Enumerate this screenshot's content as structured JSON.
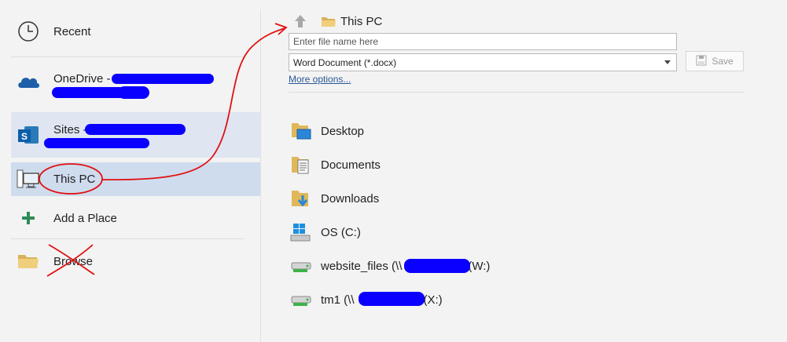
{
  "places": {
    "recent": "Recent",
    "onedrive": "OneDrive -",
    "sites": "Sites -",
    "this_pc": "This PC",
    "add_place": "Add a Place",
    "browse": "Browse"
  },
  "breadcrumb": "This PC",
  "filename": {
    "placeholder": "Enter file name here",
    "value": ""
  },
  "file_type": "Word Document (*.docx)",
  "save_label": "Save",
  "more_options": "More options...",
  "locations": [
    {
      "label": "Desktop",
      "icon": "desktop-folder-icon"
    },
    {
      "label": "Documents",
      "icon": "documents-folder-icon"
    },
    {
      "label": "Downloads",
      "icon": "downloads-folder-icon"
    },
    {
      "label": "OS (C:)",
      "icon": "windows-drive-icon"
    },
    {
      "prefix": "website_files (\\\\",
      "suffix": "(W:)",
      "icon": "network-drive-icon"
    },
    {
      "prefix": "tm1 (\\\\",
      "suffix": "(X:)",
      "icon": "network-drive-icon"
    }
  ],
  "colors": {
    "selection": "#cfdcee",
    "annotation_red": "#e01010",
    "redaction": "#0a00ff",
    "link": "#2b5797"
  }
}
